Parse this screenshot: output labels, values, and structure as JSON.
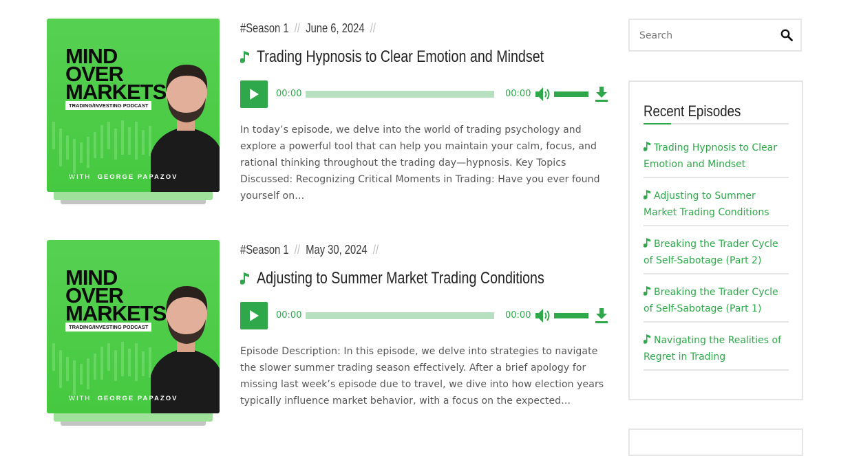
{
  "colors": {
    "accent": "#2ea84a",
    "progress_track": "#b7e0c0",
    "cover_green": "#4ccb47"
  },
  "episodes": [
    {
      "cover": {
        "line1": "MIND",
        "line2": "OVER",
        "line3": "MARKETS",
        "tagline": "TRADING/INVESTING PODCAST",
        "host_prefix": "WITH",
        "host_name": "GEORGE PAPAZOV"
      },
      "season": "#Season 1",
      "date": "June 6, 2024",
      "title": "Trading Hypnosis to Clear Emotion and Mindset",
      "player": {
        "current_time": "00:00",
        "duration": "00:00",
        "progress": 0,
        "volume": 1
      },
      "description": "In today’s episode, we delve into the world of trading psychology and explore a powerful tool that can help you maintain your calm, focus, and rational thinking throughout the trading day—hypnosis. Key Topics Discussed: Recognizing Critical Moments in Trading: Have you ever found yourself on…"
    },
    {
      "cover": {
        "line1": "MIND",
        "line2": "OVER",
        "line3": "MARKETS",
        "tagline": "TRADING/INVESTING PODCAST",
        "host_prefix": "WITH",
        "host_name": "GEORGE PAPAZOV"
      },
      "season": "#Season 1",
      "date": "May 30, 2024",
      "title": "Adjusting to Summer Market Trading Conditions",
      "player": {
        "current_time": "00:00",
        "duration": "00:00",
        "progress": 0,
        "volume": 1
      },
      "description": "Episode Description: In this episode, we delve into strategies to navigate the slower summer trading season effectively. After a brief apology for missing last week’s episode due to travel, we dive into how election years typically influence market behavior, with a focus on the expected…"
    }
  ],
  "sidebar": {
    "search": {
      "placeholder": "Search"
    },
    "recent": {
      "title": "Recent Episodes",
      "items": [
        "Trading Hypnosis to Clear Emotion and Mindset",
        "Adjusting to Summer Market Trading Conditions",
        "Breaking the Trader Cycle of Self-Sabotage (Part 2)",
        "Breaking the Trader Cycle of Self-Sabotage (Part 1)",
        "Navigating the Realities of Regret in Trading"
      ]
    }
  },
  "icons": {
    "play": "play-icon",
    "volume": "volume-icon",
    "download": "download-icon",
    "search": "search-icon",
    "note": "music-note-icon"
  }
}
